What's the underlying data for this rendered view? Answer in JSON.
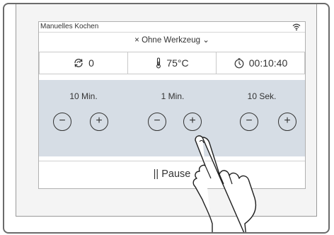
{
  "statusbar": {
    "title": "Manuelles Kochen",
    "wifi_icon": "wifi-icon"
  },
  "tool_selector": {
    "label": "Ohne Werkzeug",
    "close_icon": "×",
    "chevron_icon": "⌄"
  },
  "params": {
    "speed": {
      "icon": "speed-icon",
      "value": "0"
    },
    "temperature": {
      "icon": "thermometer-icon",
      "value": "75°C"
    },
    "timer": {
      "icon": "timer-icon",
      "value": "00:10:40"
    }
  },
  "adjusters": [
    {
      "label": "10 Min.",
      "minus": "−",
      "plus": "+"
    },
    {
      "label": "1 Min.",
      "minus": "−",
      "plus": "+"
    },
    {
      "label": "10 Sek.",
      "minus": "−",
      "plus": "+"
    }
  ],
  "pause": {
    "icon": "||",
    "label": "Pause"
  },
  "colors": {
    "panel": "#d6dde5",
    "frame": "#6b6b6b"
  }
}
